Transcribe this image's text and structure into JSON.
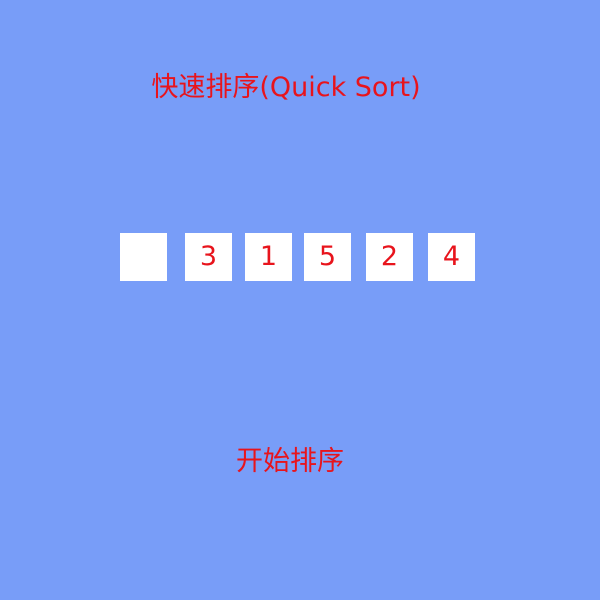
{
  "title": "快速排序(Quick Sort)",
  "array": {
    "pivot_slot": "",
    "values": [
      "3",
      "1",
      "5",
      "2",
      "4"
    ]
  },
  "start_button_label": "开始排序",
  "colors": {
    "background": "#789df8",
    "text": "#e8141c",
    "cell": "#ffffff"
  }
}
